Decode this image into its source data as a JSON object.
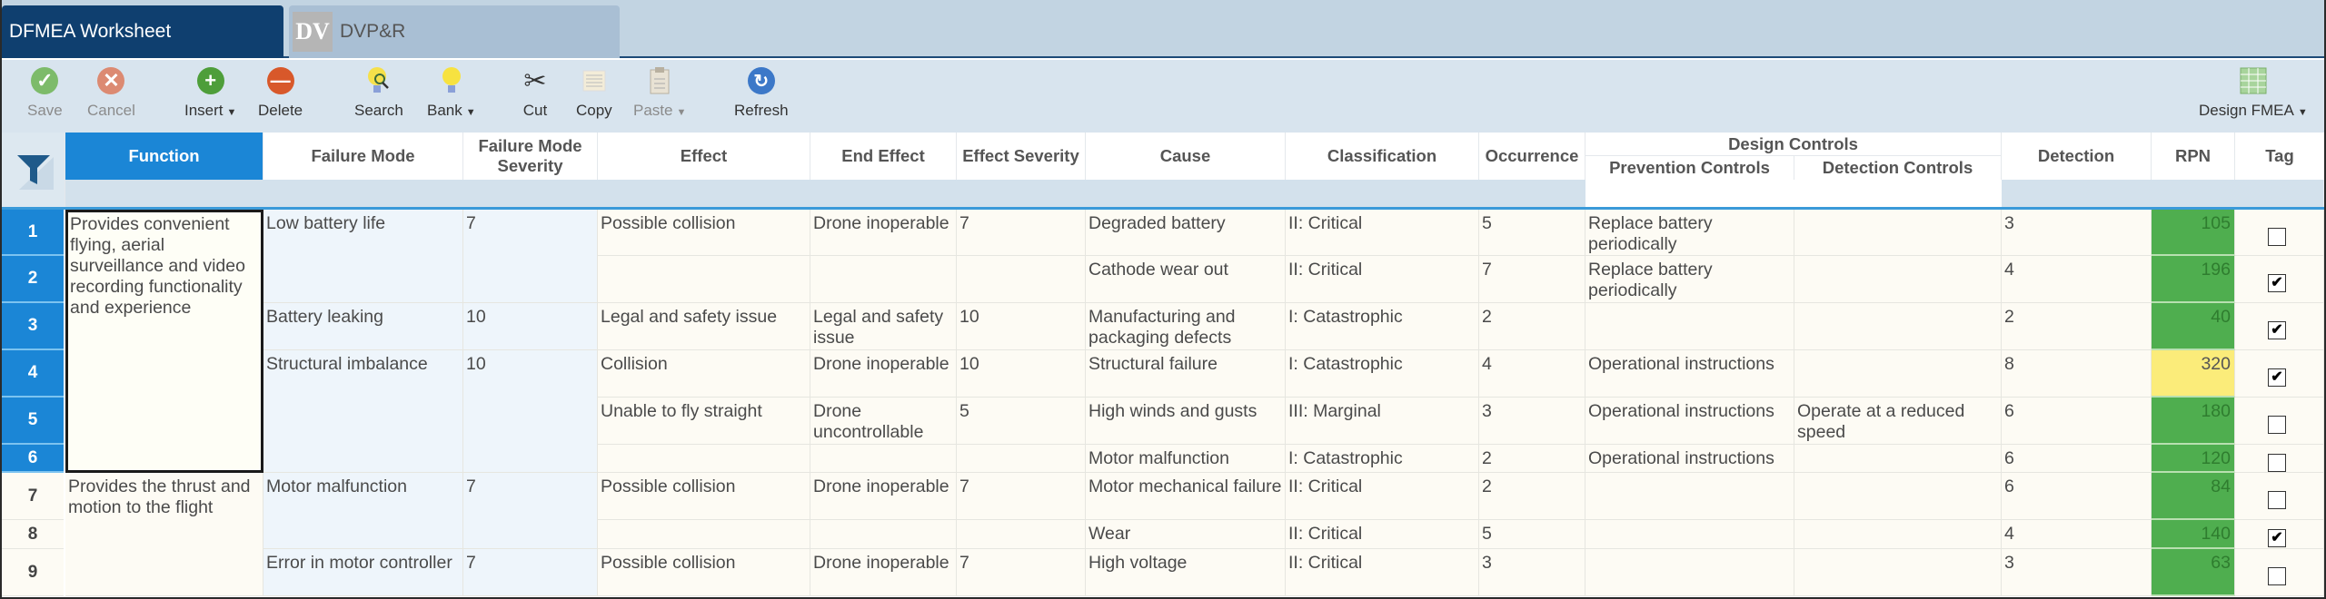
{
  "tabs": [
    {
      "label": "DFMEA Worksheet",
      "active": true
    },
    {
      "label": "DVP&R",
      "badge": "DV",
      "active": false
    }
  ],
  "toolbar": {
    "save": "Save",
    "cancel": "Cancel",
    "insert": "Insert",
    "delete": "Delete",
    "search": "Search",
    "bank": "Bank",
    "cut": "Cut",
    "copy": "Copy",
    "paste": "Paste",
    "refresh": "Refresh",
    "view": "Design FMEA"
  },
  "colors": {
    "accent": "#1b86d6",
    "rpn_low": "#4fae4f",
    "rpn_high": "#fbec7a",
    "tab_active": "#0f3f6f"
  },
  "columns": {
    "function": "Function",
    "failure_mode": "Failure Mode",
    "fm_severity": "Failure Mode Severity",
    "effect": "Effect",
    "end_effect": "End Effect",
    "effect_severity": "Effect Severity",
    "cause": "Cause",
    "classification": "Classification",
    "occurrence": "Occurrence",
    "design_controls": "Design Controls",
    "prevention": "Prevention Controls",
    "detection_controls": "Detection Controls",
    "detection": "Detection",
    "rpn": "RPN",
    "tag": "Tag"
  },
  "functions": [
    {
      "text": "Provides convenient flying, aerial surveillance and video recording functionality and experience",
      "rows": [
        1,
        6
      ]
    },
    {
      "text": "Provides the thrust and motion to the flight",
      "rows": [
        7,
        9
      ]
    }
  ],
  "failure_modes": [
    {
      "text": "Low battery life",
      "severity": "7",
      "rows": [
        1,
        2
      ]
    },
    {
      "text": "Battery leaking",
      "severity": "10",
      "rows": [
        3,
        3
      ]
    },
    {
      "text": "Structural imbalance",
      "severity": "10",
      "rows": [
        4,
        6
      ]
    },
    {
      "text": "Motor malfunction",
      "severity": "7",
      "rows": [
        7,
        8
      ]
    },
    {
      "text": "Error in motor controller",
      "severity": "7",
      "rows": [
        9,
        9
      ]
    }
  ],
  "effects": [
    {
      "effect": "Possible collision",
      "end_effect": "Drone inoperable",
      "severity": "7",
      "rows": [
        1,
        1
      ]
    },
    {
      "effect": "",
      "end_effect": "",
      "severity": "",
      "rows": [
        2,
        2
      ]
    },
    {
      "effect": "Legal and safety issue",
      "end_effect": "Legal and safety issue",
      "severity": "10",
      "rows": [
        3,
        3
      ]
    },
    {
      "effect": "Collision",
      "end_effect": "Drone inoperable",
      "severity": "10",
      "rows": [
        4,
        4
      ]
    },
    {
      "effect": "Unable to fly straight",
      "end_effect": "Drone uncontrollable",
      "severity": "5",
      "rows": [
        5,
        5
      ]
    },
    {
      "effect": "",
      "end_effect": "",
      "severity": "",
      "rows": [
        6,
        6
      ]
    },
    {
      "effect": "Possible collision",
      "end_effect": "Drone inoperable",
      "severity": "7",
      "rows": [
        7,
        7
      ]
    },
    {
      "effect": "",
      "end_effect": "",
      "severity": "",
      "rows": [
        8,
        8
      ]
    },
    {
      "effect": "Possible collision",
      "end_effect": "Drone inoperable",
      "severity": "7",
      "rows": [
        9,
        9
      ]
    }
  ],
  "rows": [
    {
      "num": "1",
      "selected": true,
      "cause": "Degraded battery",
      "classification": "II: Critical",
      "occurrence": "5",
      "prevention": "Replace battery periodically",
      "detection_controls": "",
      "detection": "3",
      "rpn": "105",
      "rpn_level": "green",
      "tag": false
    },
    {
      "num": "2",
      "selected": true,
      "cause": "Cathode wear out",
      "classification": "II: Critical",
      "occurrence": "7",
      "prevention": "Replace battery periodically",
      "detection_controls": "",
      "detection": "4",
      "rpn": "196",
      "rpn_level": "green",
      "tag": true
    },
    {
      "num": "3",
      "selected": true,
      "cause": "Manufacturing and packaging defects",
      "classification": "I: Catastrophic",
      "occurrence": "2",
      "prevention": "",
      "detection_controls": "",
      "detection": "2",
      "rpn": "40",
      "rpn_level": "green",
      "tag": true
    },
    {
      "num": "4",
      "selected": true,
      "cause": "Structural failure",
      "classification": "I: Catastrophic",
      "occurrence": "4",
      "prevention": "Operational instructions",
      "detection_controls": "",
      "detection": "8",
      "rpn": "320",
      "rpn_level": "yellow",
      "tag": true
    },
    {
      "num": "5",
      "selected": true,
      "cause": "High winds and gusts",
      "classification": "III: Marginal",
      "occurrence": "3",
      "prevention": "Operational instructions",
      "detection_controls": "Operate at a reduced speed",
      "detection": "6",
      "rpn": "180",
      "rpn_level": "green",
      "tag": false
    },
    {
      "num": "6",
      "selected": true,
      "cause": "Motor malfunction",
      "classification": "I: Catastrophic",
      "occurrence": "2",
      "prevention": "Operational instructions",
      "detection_controls": "",
      "detection": "6",
      "rpn": "120",
      "rpn_level": "green",
      "tag": false
    },
    {
      "num": "7",
      "selected": false,
      "cause": "Motor mechanical failure",
      "classification": "II: Critical",
      "occurrence": "2",
      "prevention": "",
      "detection_controls": "",
      "detection": "6",
      "rpn": "84",
      "rpn_level": "green",
      "tag": false
    },
    {
      "num": "8",
      "selected": false,
      "cause": "Wear",
      "classification": "II: Critical",
      "occurrence": "5",
      "prevention": "",
      "detection_controls": "",
      "detection": "4",
      "rpn": "140",
      "rpn_level": "green",
      "tag": true
    },
    {
      "num": "9",
      "selected": false,
      "cause": "High voltage",
      "classification": "II: Critical",
      "occurrence": "3",
      "prevention": "",
      "detection_controls": "",
      "detection": "3",
      "rpn": "63",
      "rpn_level": "green",
      "tag": false
    }
  ]
}
